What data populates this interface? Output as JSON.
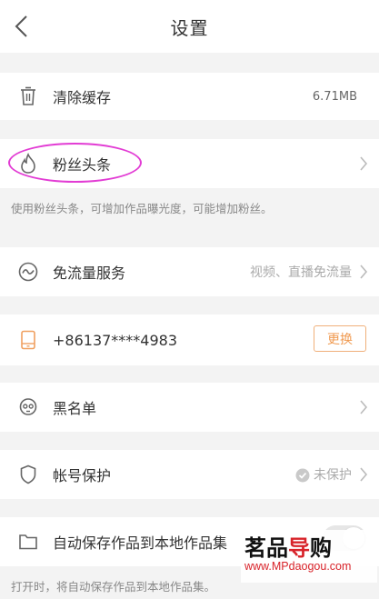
{
  "header": {
    "title": "设置",
    "back_icon": "back-arrow-icon"
  },
  "rows": {
    "clear_cache": {
      "label": "清除缓存",
      "value": "6.71MB",
      "icon": "trash-icon"
    },
    "fans_headline": {
      "label": "粉丝头条",
      "icon": "flame-icon",
      "description": "使用粉丝头条，可增加作品曝光度，可能增加粉丝。"
    },
    "free_data": {
      "label": "免流量服务",
      "value": "视频、直播免流量",
      "icon": "wave-circle-icon"
    },
    "phone": {
      "label": "+86137****4983",
      "button": "更换",
      "icon": "phone-icon"
    },
    "blacklist": {
      "label": "黑名单",
      "icon": "skull-icon"
    },
    "account_protect": {
      "label": "帐号保护",
      "value": "未保护",
      "icon": "shield-icon"
    },
    "auto_save": {
      "label": "自动保存作品到本地作品集",
      "icon": "folder-icon",
      "description": "打开时，将自动保存作品到本地作品集。",
      "enabled": false
    }
  },
  "watermark": {
    "brand_black": "茗品",
    "brand_red": "导",
    "brand_tail": "购",
    "url": "www.MPdaogou.com"
  },
  "colors": {
    "accent": "#f09a50",
    "highlight": "#e23cd4",
    "watermark_red": "#d8232a"
  }
}
